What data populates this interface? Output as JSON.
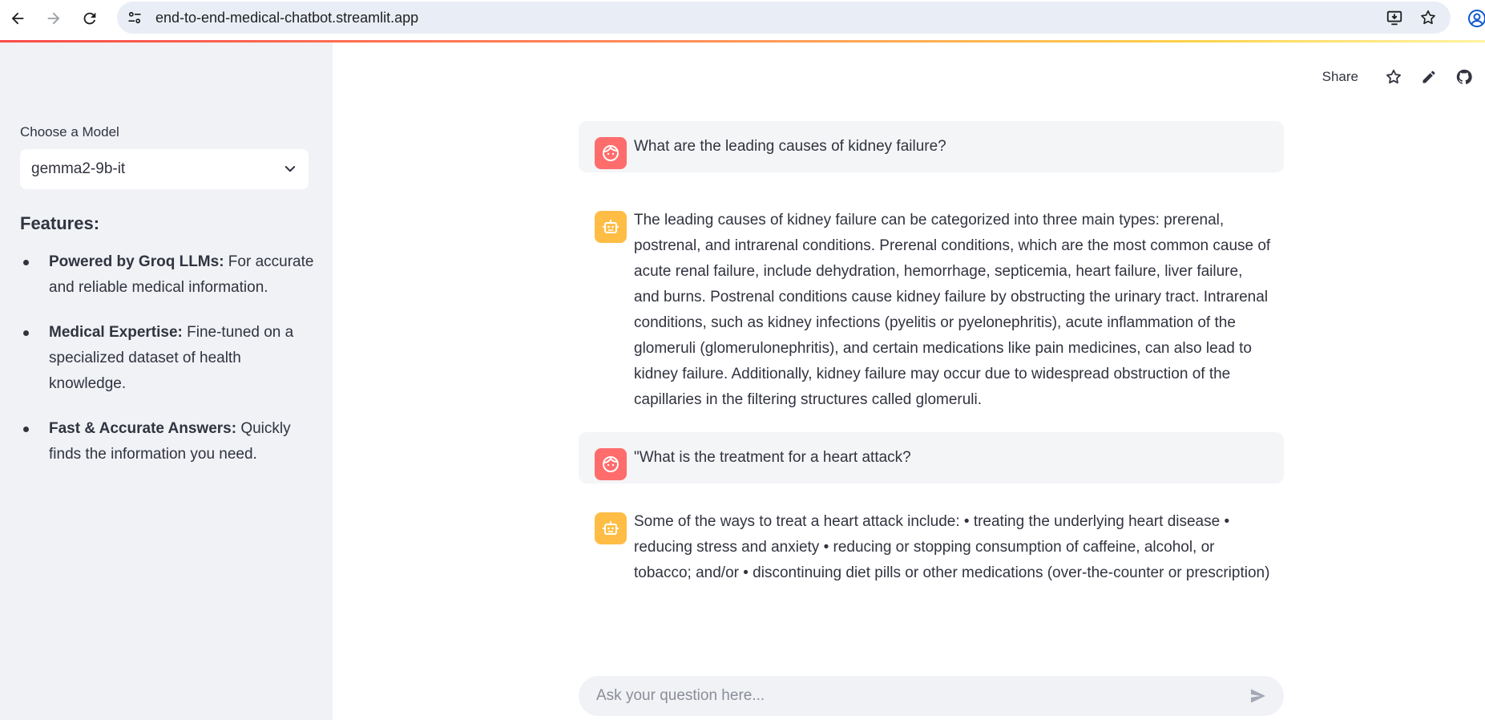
{
  "browser": {
    "url": "end-to-end-medical-chatbot.streamlit.app",
    "icons": [
      "back-icon",
      "forward-icon",
      "reload-icon",
      "site-info-icon",
      "install-app-icon",
      "bookmark-star-icon",
      "profile-icon"
    ]
  },
  "sidebar": {
    "model_label": "Choose a Model",
    "model_selected": "gemma2-9b-it",
    "features_title": "Features:",
    "features": [
      {
        "title": "Powered by Groq LLMs:",
        "text": " For accurate and reliable medical information."
      },
      {
        "title": "Medical Expertise:",
        "text": " Fine-tuned on a specialized dataset of health knowledge."
      },
      {
        "title": "Fast & Accurate Answers:",
        "text": " Quickly finds the information you need."
      }
    ]
  },
  "header": {
    "share_label": "Share",
    "icons": [
      "star-icon",
      "edit-icon",
      "github-icon"
    ]
  },
  "chat": {
    "messages": [
      {
        "role": "user",
        "text": "What are the leading causes of kidney failure?"
      },
      {
        "role": "assistant",
        "text": "The leading causes of kidney failure can be categorized into three main types: prerenal, postrenal, and intrarenal conditions. Prerenal conditions, which are the most common cause of acute renal failure, include dehydration, hemorrhage, septicemia, heart failure, liver failure, and burns. Postrenal conditions cause kidney failure by obstructing the urinary tract. Intrarenal conditions, such as kidney infections (pyelitis or pyelonephritis), acute inflammation of the glomeruli (glomerulonephritis), and certain medications like pain medicines, can also lead to kidney failure. Additionally, kidney failure may occur due to widespread obstruction of the capillaries in the filtering structures called glomeruli."
      },
      {
        "role": "user",
        "text": "\"What is the treatment for a heart attack?"
      },
      {
        "role": "assistant",
        "text": "Some of the ways to treat a heart attack include: • treating the underlying heart disease • reducing stress and anxiety • reducing or stopping consumption of caffeine, alcohol, or tobacco; and/or • discontinuing diet pills or other medications (over-the-counter or prescription)"
      }
    ],
    "input_placeholder": "Ask your question here...",
    "input_value": ""
  },
  "colors": {
    "sidebar_bg": "#f0f2f6",
    "user_avatar": "#ff6c6c",
    "assistant_avatar": "#ffbd45",
    "text": "#31333f"
  }
}
